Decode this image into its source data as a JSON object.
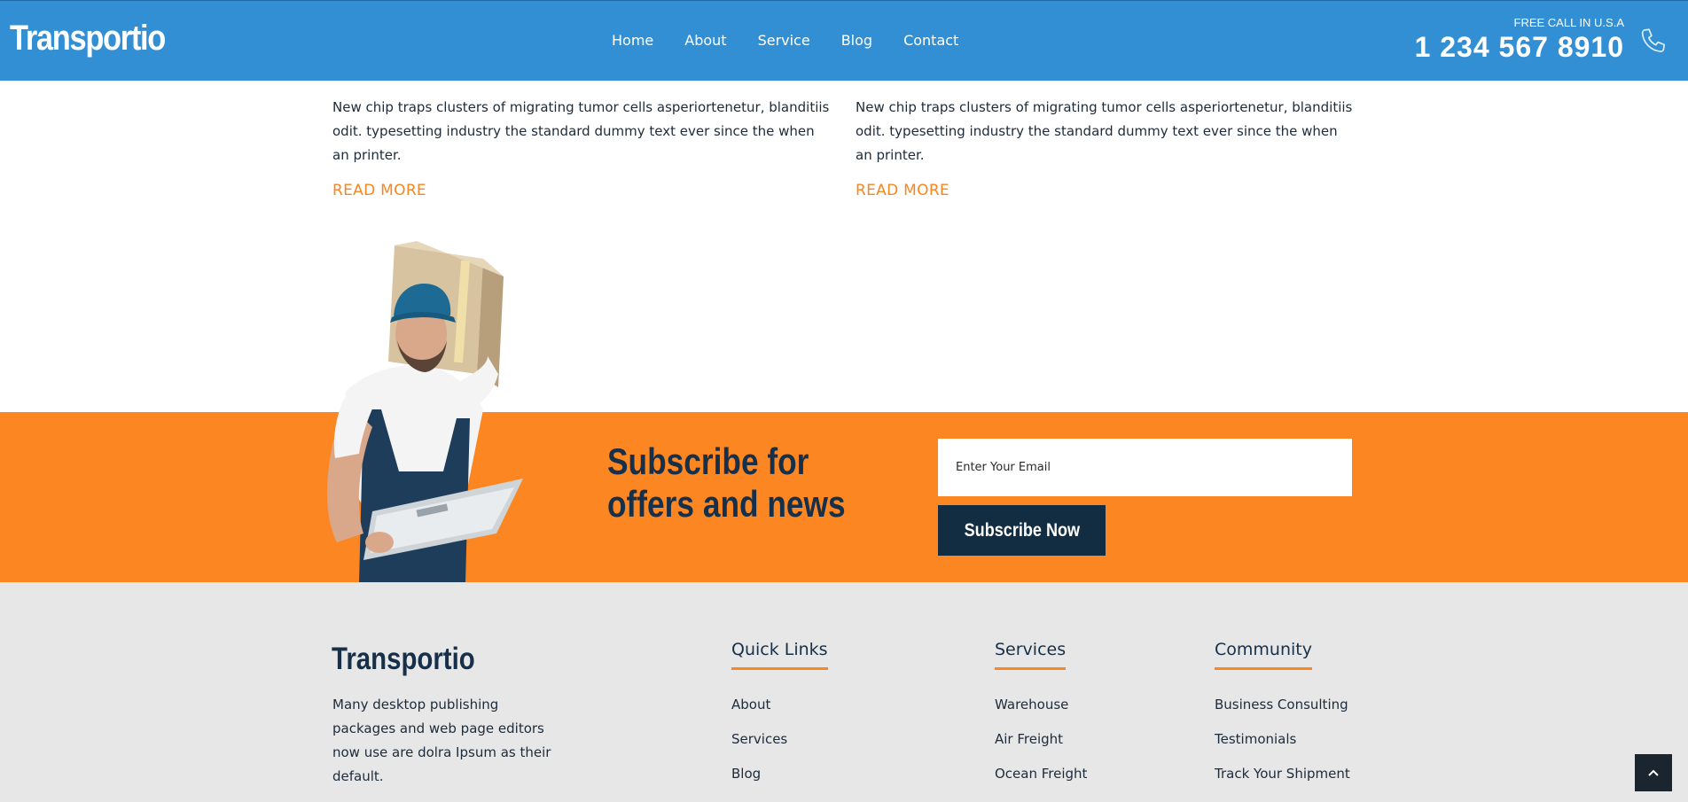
{
  "header": {
    "logo": "Transportio",
    "nav": [
      "Home",
      "About",
      "Service",
      "Blog",
      "Contact"
    ],
    "call_label": "FREE CALL IN U.S.A",
    "call_number": "1 234 567 8910",
    "phone_icon": "phone-icon"
  },
  "articles": [
    {
      "text": "New chip traps clusters of migrating tumor cells asperiortenetur, blanditiis odit. typesetting industry the standard dummy text ever since the when an printer.",
      "read_more": "READ MORE"
    },
    {
      "text": "New chip traps clusters of migrating tumor cells asperiortenetur, blanditiis odit. typesetting industry the standard dummy text ever since the when an printer.",
      "read_more": "READ MORE"
    }
  ],
  "subscribe": {
    "title": "Subscribe for offers and news",
    "email_placeholder": "Enter Your Email",
    "button": "Subscribe Now"
  },
  "footer": {
    "logo": "Transportio",
    "description": "Many desktop publishing packages and web page editors now use are dolra Ipsum as their default.",
    "quick_links": {
      "title": "Quick Links",
      "items": [
        "About",
        "Services",
        "Blog"
      ]
    },
    "services": {
      "title": "Services",
      "items": [
        "Warehouse",
        "Air Freight",
        "Ocean Freight"
      ]
    },
    "community": {
      "title": "Community",
      "items": [
        "Business Consulting",
        "Testimonials",
        "Track Your Shipment"
      ]
    }
  },
  "scroll_top_icon": "chevron-up-icon",
  "colors": {
    "header_blue": "#338fd4",
    "accent_orange": "#fc8722",
    "navy": "#17304a",
    "footer_bg": "#e7e7e7"
  }
}
